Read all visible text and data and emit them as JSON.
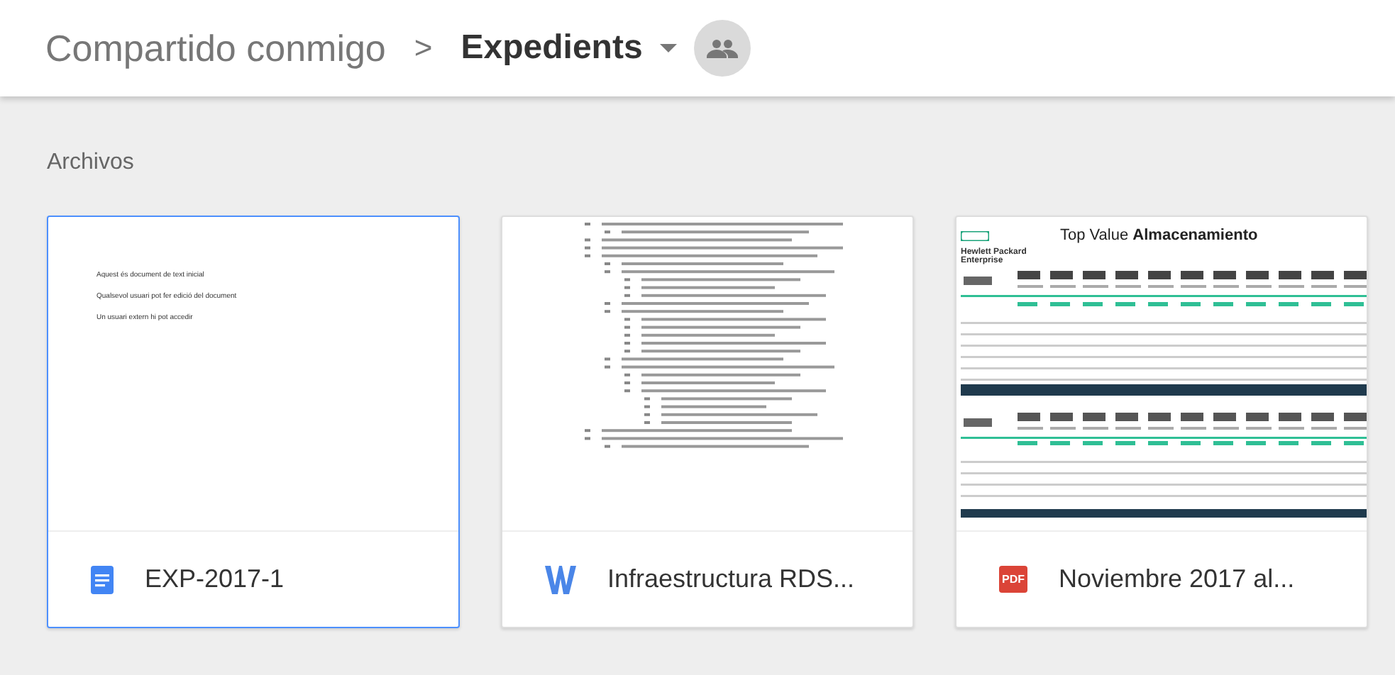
{
  "breadcrumb": {
    "parent": "Compartido conmigo",
    "separator": ">",
    "current": "Expedients"
  },
  "section_title": "Archivos",
  "files": [
    {
      "kind": "doc",
      "name": "EXP-2017-1",
      "selected": true,
      "preview_lines": [
        "Aquest és document de text inicial",
        "Qualsevol usuari pot fer edició del document",
        "Un usuari extern hi pot accedir"
      ]
    },
    {
      "kind": "word",
      "name": "Infraestructura RDS...",
      "selected": false
    },
    {
      "kind": "pdf",
      "name": "Noviembre 2017 al...",
      "selected": false,
      "preview_title": "Top Value **Almacenamiento**",
      "preview_logo": "Hewlett Packard Enterprise",
      "icon_text": "PDF"
    }
  ]
}
